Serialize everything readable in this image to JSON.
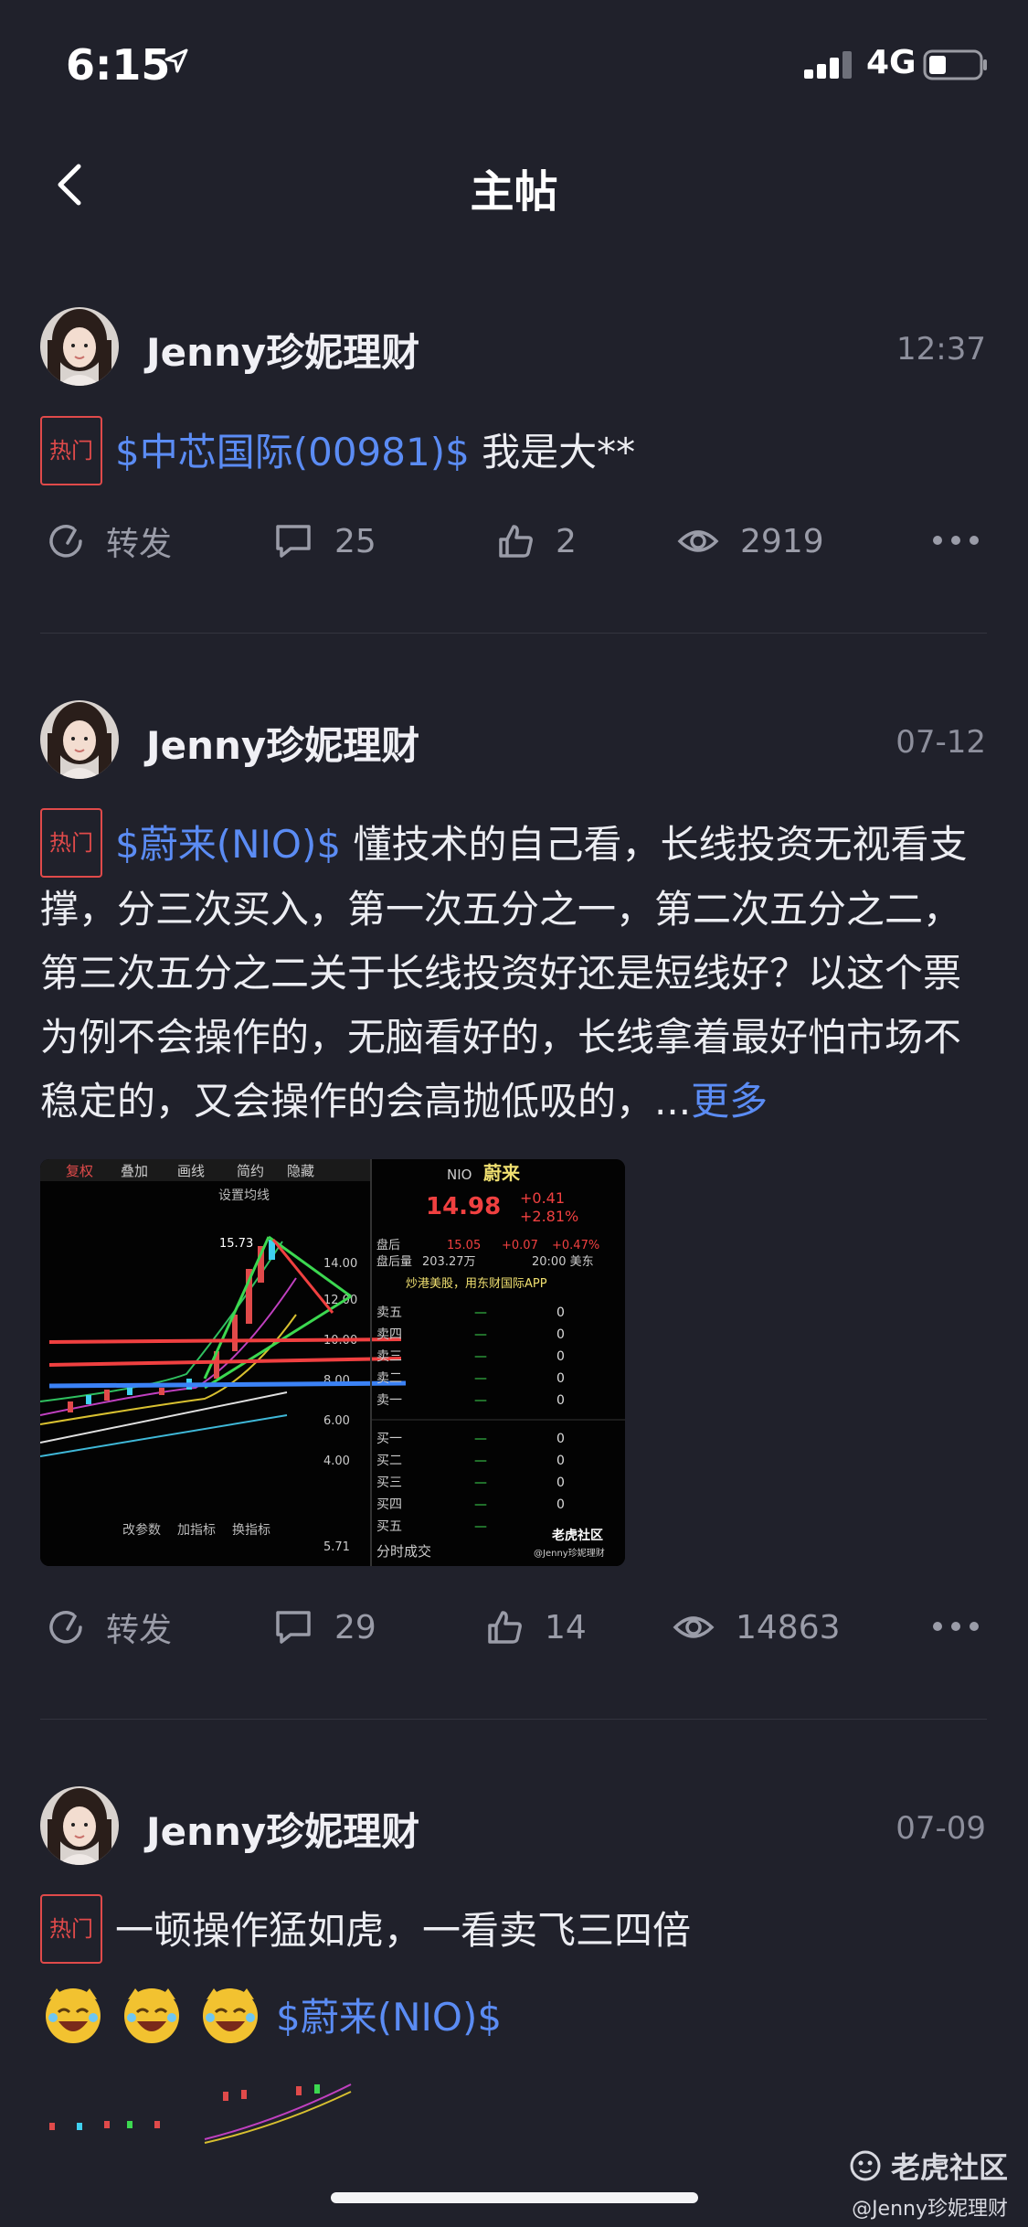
{
  "status": {
    "time": "6:15",
    "network": "4G"
  },
  "nav": {
    "title": "主帖"
  },
  "posts": [
    {
      "author": "Jenny珍妮理财",
      "date": "12:37",
      "tag": "热门",
      "stock": "$中芯国际(00981)$",
      "text": " 我是大**",
      "repost_label": "转发",
      "comments": "25",
      "likes": "2",
      "views": "2919"
    },
    {
      "author": "Jenny珍妮理财",
      "date": "07-12",
      "tag": "热门",
      "stock": "$蔚来(NIO)$",
      "text": " 懂技术的自己看，长线投资无视看支撑，分三次买入，第一次五分之一，第二次五分之二，第三次五分之二关于长线投资好还是短线好？以这个票为例不会操作的，无脑看好的，长线拿着最好怕市场不稳定的，又会操作的会高抛低吸的，...",
      "more": "更多",
      "repost_label": "转发",
      "comments": "29",
      "likes": "14",
      "views": "14863",
      "image": {
        "toolbar": [
          "复权",
          "叠加",
          "画线",
          "简约",
          "隐藏"
        ],
        "setting": "设置均线",
        "high": "15.73",
        "y_labels": [
          "14.00",
          "12.00",
          "10.00",
          "8.00",
          "6.00",
          "4.00",
          "5.71"
        ],
        "bottom_tools": [
          "改参数",
          "加指标",
          "换指标"
        ],
        "symbol": "NIO",
        "name": "蔚来",
        "price": "14.98",
        "change": "+0.41",
        "change_pct": "+2.81%",
        "after_label": "盘后",
        "after_price": "15.05",
        "after_change": "+0.07",
        "after_pct": "+0.47%",
        "after_vol_label": "盘后量",
        "after_vol": "203.27万",
        "after_time": "20:00 美东",
        "promo": "炒港美股，用东财国际APP",
        "sell_levels": [
          "卖五",
          "卖四",
          "卖三",
          "卖二",
          "卖一"
        ],
        "buy_levels": [
          "买一",
          "买二",
          "买三",
          "买四",
          "买五"
        ],
        "dash": "—",
        "zero": "0",
        "footer_left": "分时成交",
        "wm_brand": "老虎社区",
        "wm_handle": "@Jenny珍妮理财"
      }
    },
    {
      "author": "Jenny珍妮理财",
      "date": "07-09",
      "tag": "热门",
      "text": "一顿操作猛如虎，一看卖飞三四倍",
      "stock": "$蔚来(NIO)$"
    }
  ],
  "watermark": {
    "brand": "老虎社区",
    "handle": "@Jenny珍妮理财"
  },
  "colors": {
    "background": "#20212b",
    "accent": "#5b8cf4",
    "tag": "#e04a4a"
  }
}
